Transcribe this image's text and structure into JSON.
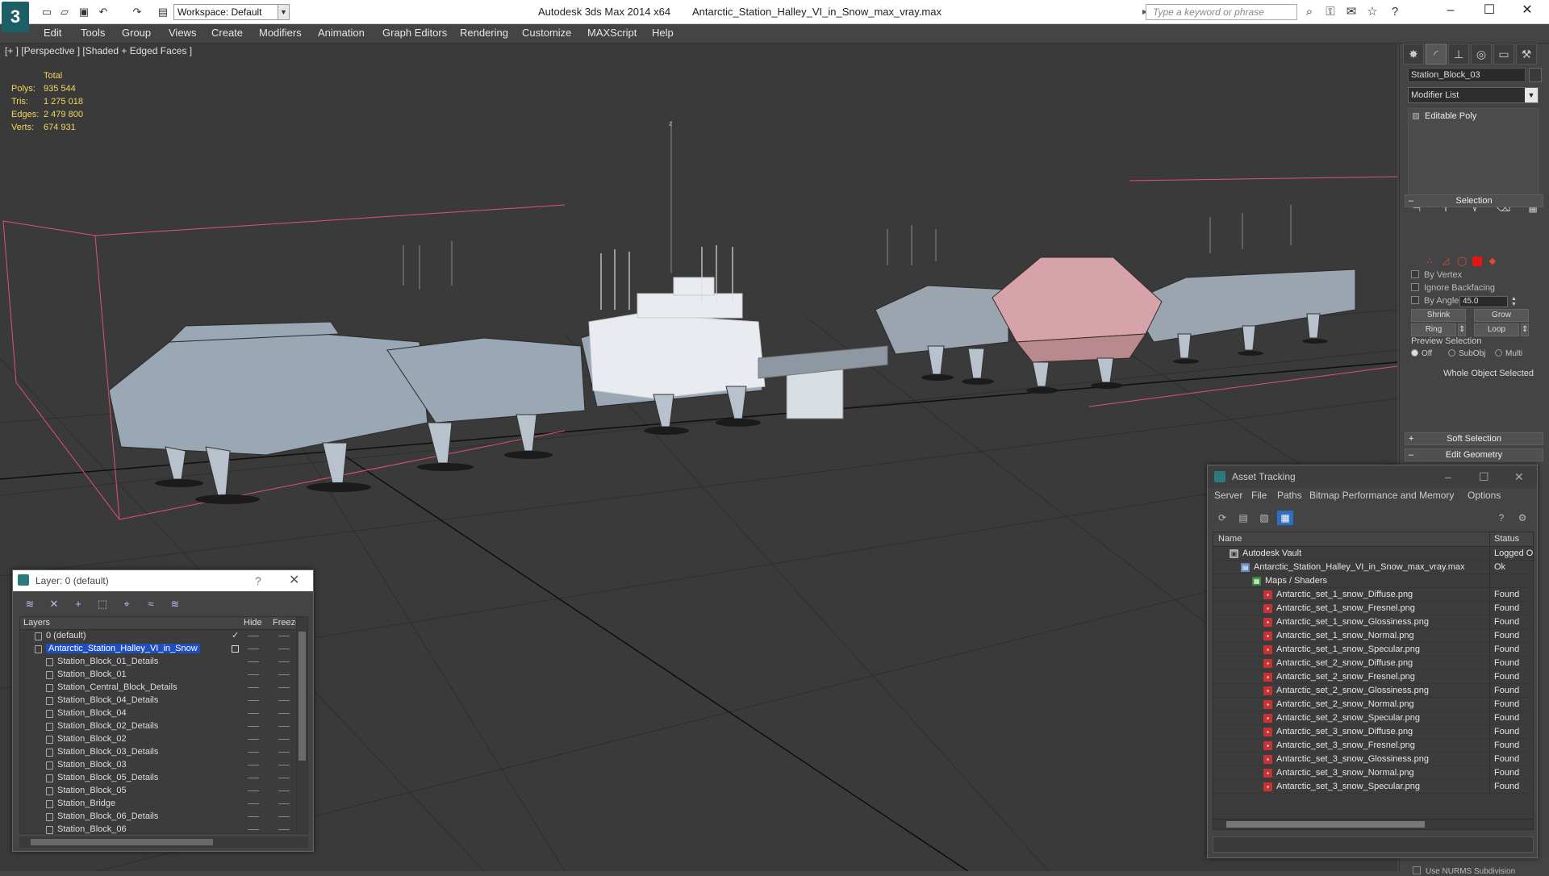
{
  "titlebar": {
    "workspace": "Workspace: Default",
    "app": "Autodesk 3ds Max  2014 x64",
    "file": "Antarctic_Station_Halley_VI_in_Snow_max_vray.max",
    "search_placeholder": "Type a keyword or phrase"
  },
  "menu": [
    "Edit",
    "Tools",
    "Group",
    "Views",
    "Create",
    "Modifiers",
    "Animation",
    "Graph Editors",
    "Rendering",
    "Customize",
    "MAXScript",
    "Help"
  ],
  "viewport": {
    "label": "[+ ] [Perspective ] [Shaded + Edged Faces ]",
    "stats_header": "Total",
    "stats": [
      {
        "k": "Polys:",
        "v": "935 544"
      },
      {
        "k": "Tris:",
        "v": "1 275 018"
      },
      {
        "k": "Edges:",
        "v": "2 479 800"
      },
      {
        "k": "Verts:",
        "v": "674 931"
      }
    ]
  },
  "command_panel": {
    "object_name": "Station_Block_03",
    "modifier_list": "Modifier List",
    "stack_item": "Editable Poly",
    "selection_title": "Selection",
    "by_vertex": "By Vertex",
    "ignore_backfacing": "Ignore Backfacing",
    "by_angle": "By Angle:",
    "angle_value": "45.0",
    "shrink": "Shrink",
    "grow": "Grow",
    "ring": "Ring",
    "loop": "Loop",
    "preview_selection": "Preview Selection",
    "off": "Off",
    "subobj": "SubObj",
    "multi": "Multi",
    "whole_object": "Whole Object Selected",
    "soft_selection": "Soft Selection",
    "edit_geometry": "Edit Geometry",
    "nurms": "Use NURMS Subdivision"
  },
  "layer_window": {
    "title": "Layer: 0 (default)",
    "help": "?",
    "col_layers": "Layers",
    "col_hide": "Hide",
    "col_freeze": "Freeze",
    "rows": [
      {
        "name": "0 (default)",
        "level": 1
      },
      {
        "name": "Antarctic_Station_Halley_VI_in_Snow",
        "level": 1,
        "selected": true
      },
      {
        "name": "Station_Block_01_Details",
        "level": 2
      },
      {
        "name": "Station_Block_01",
        "level": 2
      },
      {
        "name": "Station_Central_Block_Details",
        "level": 2
      },
      {
        "name": "Station_Block_04_Details",
        "level": 2
      },
      {
        "name": "Station_Block_04",
        "level": 2
      },
      {
        "name": "Station_Block_02_Details",
        "level": 2
      },
      {
        "name": "Station_Block_02",
        "level": 2
      },
      {
        "name": "Station_Block_03_Details",
        "level": 2
      },
      {
        "name": "Station_Block_03",
        "level": 2
      },
      {
        "name": "Station_Block_05_Details",
        "level": 2
      },
      {
        "name": "Station_Block_05",
        "level": 2
      },
      {
        "name": "Station_Bridge",
        "level": 2
      },
      {
        "name": "Station_Block_06_Details",
        "level": 2
      },
      {
        "name": "Station_Block_06",
        "level": 2
      }
    ]
  },
  "asset_tracking": {
    "title": "Asset Tracking",
    "menu": [
      "Server",
      "File",
      "Paths",
      "Bitmap Performance and Memory",
      "Options"
    ],
    "col_name": "Name",
    "col_status": "Status",
    "rows": [
      {
        "name": "Autodesk Vault",
        "status": "Logged O",
        "icon": "vault",
        "level": 0
      },
      {
        "name": "Antarctic_Station_Halley_VI_in_Snow_max_vray.max",
        "status": "Ok",
        "icon": "file",
        "level": 1
      },
      {
        "name": "Maps / Shaders",
        "status": "",
        "icon": "maps",
        "level": 2
      },
      {
        "name": "Antarctic_set_1_snow_Diffuse.png",
        "status": "Found",
        "icon": "png",
        "level": 3
      },
      {
        "name": "Antarctic_set_1_snow_Fresnel.png",
        "status": "Found",
        "icon": "png",
        "level": 3
      },
      {
        "name": "Antarctic_set_1_snow_Glossiness.png",
        "status": "Found",
        "icon": "png",
        "level": 3
      },
      {
        "name": "Antarctic_set_1_snow_Normal.png",
        "status": "Found",
        "icon": "png",
        "level": 3
      },
      {
        "name": "Antarctic_set_1_snow_Specular.png",
        "status": "Found",
        "icon": "png",
        "level": 3
      },
      {
        "name": "Antarctic_set_2_snow_Diffuse.png",
        "status": "Found",
        "icon": "png",
        "level": 3
      },
      {
        "name": "Antarctic_set_2_snow_Fresnel.png",
        "status": "Found",
        "icon": "png",
        "level": 3
      },
      {
        "name": "Antarctic_set_2_snow_Glossiness.png",
        "status": "Found",
        "icon": "png",
        "level": 3
      },
      {
        "name": "Antarctic_set_2_snow_Normal.png",
        "status": "Found",
        "icon": "png",
        "level": 3
      },
      {
        "name": "Antarctic_set_2_snow_Specular.png",
        "status": "Found",
        "icon": "png",
        "level": 3
      },
      {
        "name": "Antarctic_set_3_snow_Diffuse.png",
        "status": "Found",
        "icon": "png",
        "level": 3
      },
      {
        "name": "Antarctic_set_3_snow_Fresnel.png",
        "status": "Found",
        "icon": "png",
        "level": 3
      },
      {
        "name": "Antarctic_set_3_snow_Glossiness.png",
        "status": "Found",
        "icon": "png",
        "level": 3
      },
      {
        "name": "Antarctic_set_3_snow_Normal.png",
        "status": "Found",
        "icon": "png",
        "level": 3
      },
      {
        "name": "Antarctic_set_3_snow_Specular.png",
        "status": "Found",
        "icon": "png",
        "level": 3
      }
    ]
  },
  "colors": {
    "accent": "#1d4fc2",
    "stats": "#f5d55a",
    "selection_red": "#e21616",
    "bounding_box": "#e0507a"
  }
}
